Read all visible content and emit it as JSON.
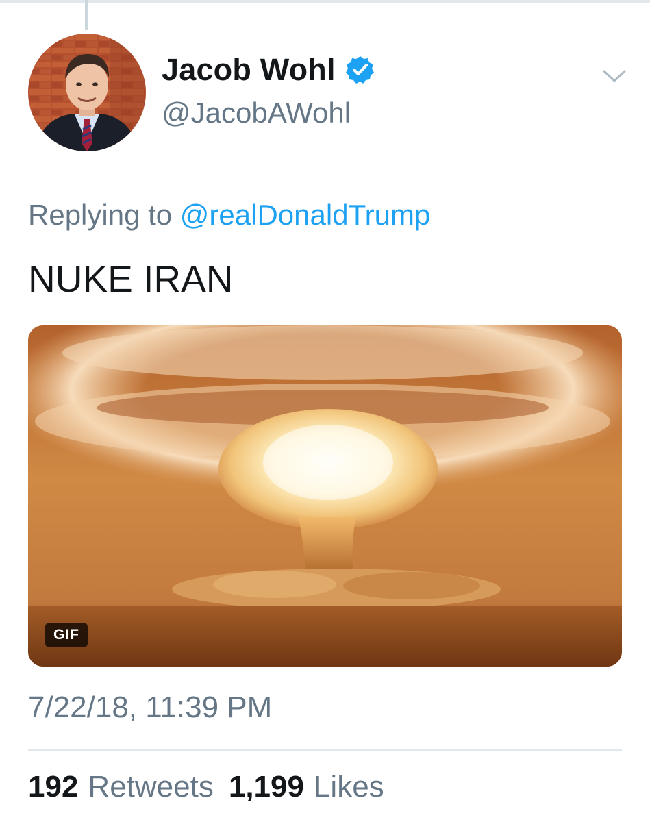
{
  "tweet": {
    "display_name": "Jacob Wohl",
    "handle": "@JacobAWohl",
    "verified": true,
    "replying_to_prefix": "Replying to",
    "replying_to_user": "@realDonaldTrump",
    "text": "NUKE IRAN",
    "media": {
      "type": "gif",
      "badge": "GIF"
    },
    "timestamp": "7/22/18, 11:39 PM",
    "stats": {
      "retweets_count": "192",
      "retweets_label": "Retweets",
      "likes_count": "1,199",
      "likes_label": "Likes"
    }
  },
  "colors": {
    "link": "#1da1f2",
    "secondary_text": "#657786",
    "primary_text": "#14171a",
    "verified_badge": "#1da1f2"
  },
  "icons": {
    "verified": "verified-badge-icon",
    "more": "chevron-down-icon"
  }
}
